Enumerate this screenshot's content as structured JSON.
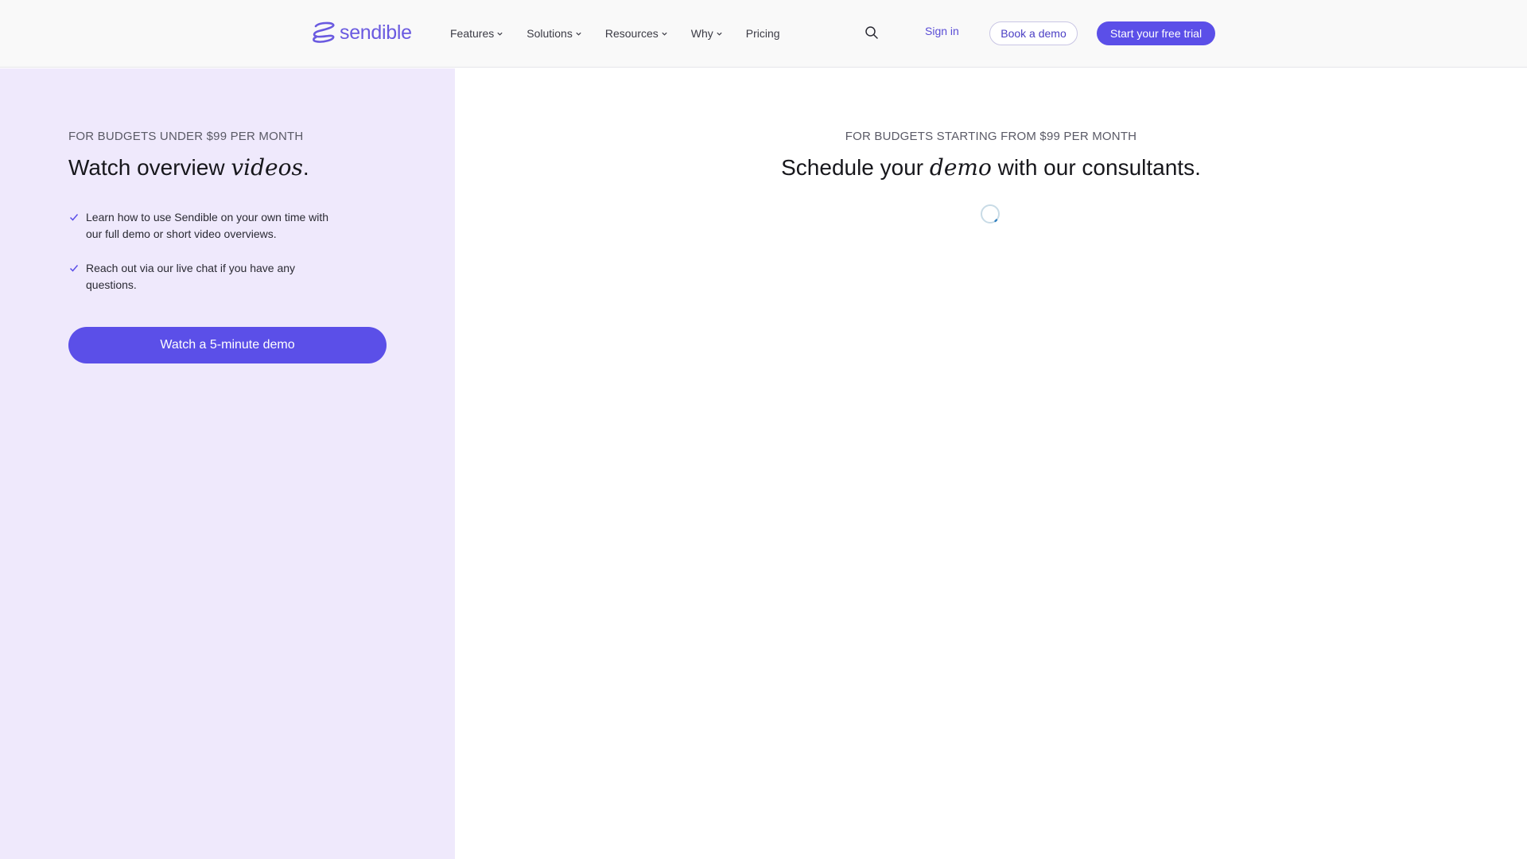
{
  "header": {
    "logo": {
      "text": "sendible",
      "icon": "sendible-swirl-logo-icon"
    },
    "nav": [
      {
        "label": "Features",
        "has_dropdown": true
      },
      {
        "label": "Solutions",
        "has_dropdown": true
      },
      {
        "label": "Resources",
        "has_dropdown": true
      },
      {
        "label": "Why",
        "has_dropdown": true
      },
      {
        "label": "Pricing",
        "has_dropdown": false
      }
    ],
    "search_icon": "search-icon",
    "sign_in": "Sign in",
    "book_demo": "Book a demo",
    "free_trial": "Start your free trial"
  },
  "left_panel": {
    "eyebrow": "FOR BUDGETS UNDER $99 PER MONTH",
    "title_pre": "Watch overview ",
    "title_em": "videos",
    "title_post": ".",
    "bullets": [
      "Learn how to use Sendible on your own time with our full demo or short video overviews.",
      "Reach out via our live chat if you have any questions."
    ],
    "button": "Watch a 5-minute demo"
  },
  "right_panel": {
    "eyebrow": "FOR BUDGETS STARTING FROM $99 PER MONTH",
    "title_pre": "Schedule your ",
    "title_em": "demo",
    "title_post": " with our consultants.",
    "loading_icon": "loading-spinner-icon"
  },
  "colors": {
    "accent": "#5b4fe8",
    "logo": "#6a5ae0",
    "left_panel_bg": "#efe9fc",
    "header_bg": "#f9f9f9"
  }
}
